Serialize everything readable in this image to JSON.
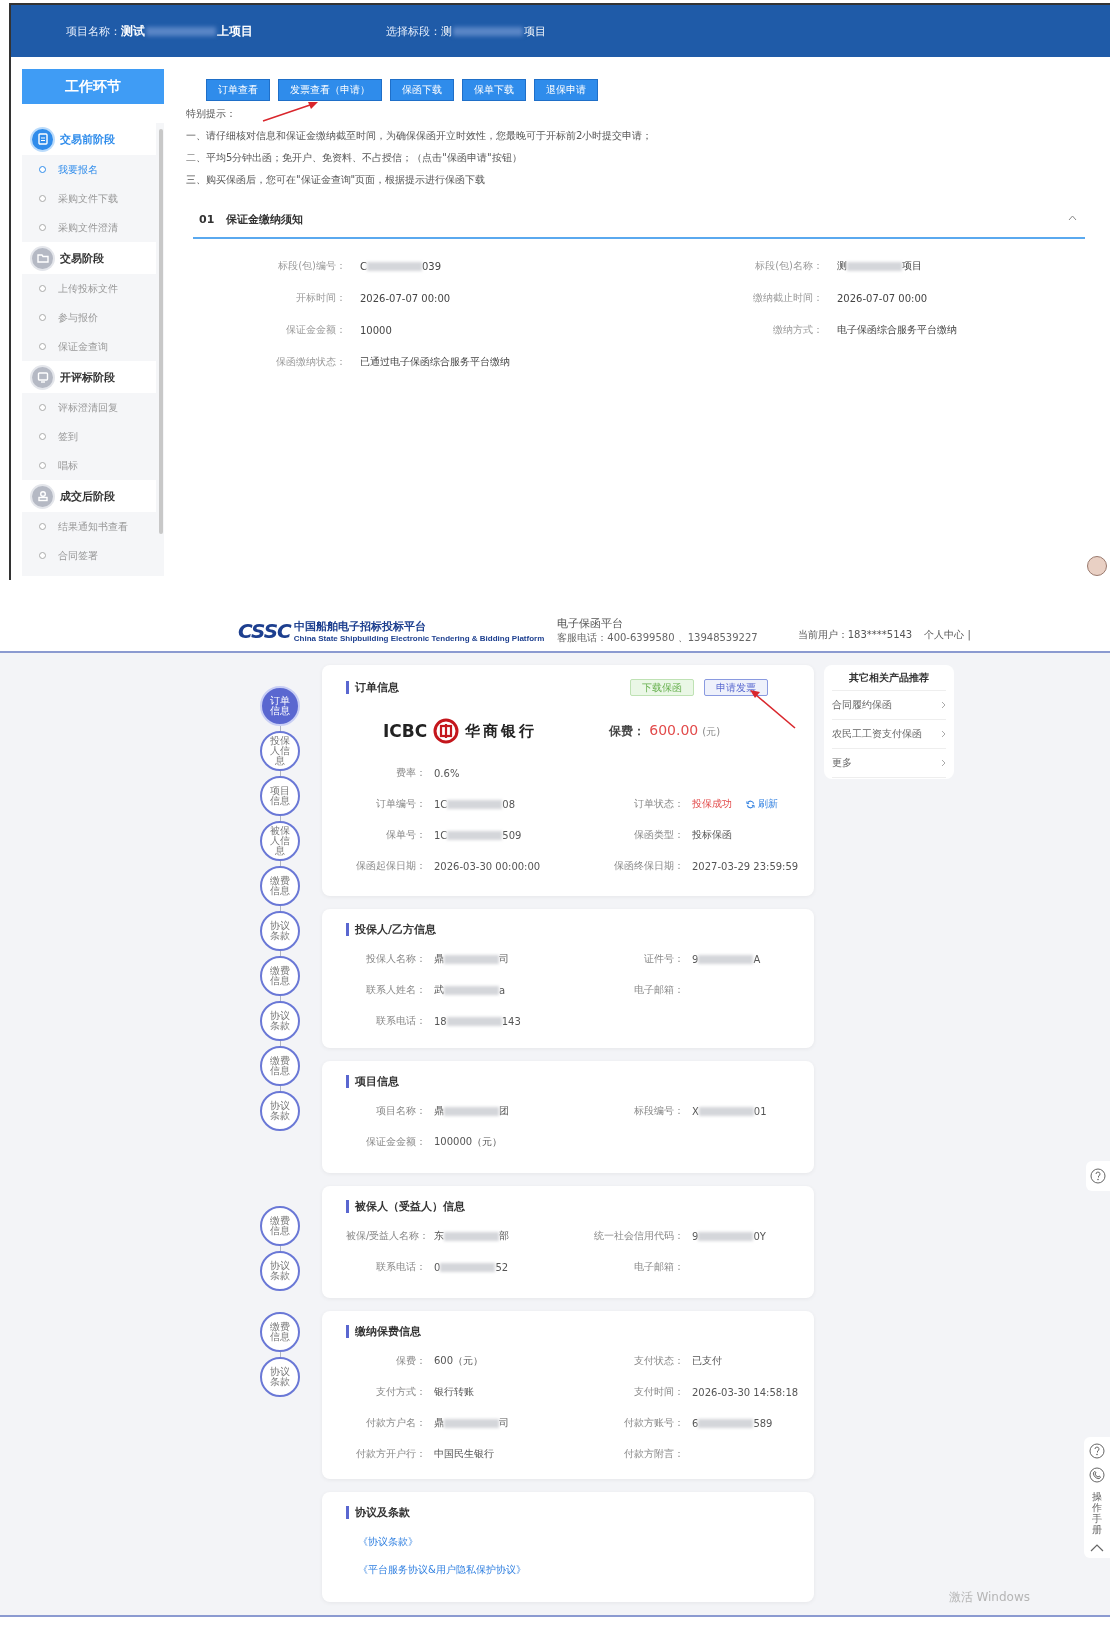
{
  "top_screen": {
    "header": {
      "project_label": "项目名称：",
      "project_value": "测试",
      "project_value_end": "上项目",
      "section_label": "选择标段：",
      "section_value": "测",
      "section_value_end": "项目"
    },
    "sidebar": {
      "title": "工作环节",
      "phases": [
        {
          "label": "交易前阶段",
          "selected": true,
          "items": [
            {
              "label": "我要报名",
              "selected": true
            },
            {
              "label": "采购文件下载",
              "selected": false
            },
            {
              "label": "采购文件澄清",
              "selected": false
            }
          ]
        },
        {
          "label": "交易阶段",
          "selected": false,
          "items": [
            {
              "label": "上传投标文件",
              "selected": false
            },
            {
              "label": "参与报价",
              "selected": false
            },
            {
              "label": "保证金查询",
              "selected": false
            }
          ]
        },
        {
          "label": "开评标阶段",
          "selected": false,
          "items": [
            {
              "label": "评标澄清回复",
              "selected": false
            },
            {
              "label": "签到",
              "selected": false
            },
            {
              "label": "唱标",
              "selected": false
            }
          ]
        },
        {
          "label": "成交后阶段",
          "selected": false,
          "items": [
            {
              "label": "结果通知书查看",
              "selected": false
            },
            {
              "label": "合同签署",
              "selected": false
            }
          ]
        }
      ]
    },
    "actions": [
      "订单查看",
      "发票查看（申请）",
      "保函下载",
      "保单下载",
      "退保申请"
    ],
    "notice": {
      "title": "特别提示：",
      "lines": [
        "一、请仔细核对信息和保证金缴纳截至时间，为确保保函开立时效性，您最晚可于开标前2小时提交申请；",
        "二、平均5分钟出函；免开户、免资料、不占授信；（点击\"保函申请\"按钮）",
        "三、购买保函后，您可在\"保证金查询\"页面，根据提示进行保函下载"
      ]
    },
    "section": {
      "number": "01",
      "title": "保证金缴纳须知",
      "expanded": true
    },
    "fields": [
      {
        "label": "标段(包)编号：",
        "value": "C",
        "value_end": "039"
      },
      {
        "label": "标段(包)名称：",
        "value": "测",
        "value_end": "项目"
      },
      {
        "label": "开标时间：",
        "value": "2026-07-07 00:00"
      },
      {
        "label": "缴纳截止时间：",
        "value": "2026-07-07 00:00"
      },
      {
        "label": "保证金金额：",
        "value": "10000"
      },
      {
        "label": "缴纳方式：",
        "value": "电子保函综合服务平台缴纳"
      },
      {
        "label": "保函缴纳状态：",
        "value": "已通过电子保函综合服务平台缴纳"
      }
    ]
  },
  "bottom_screen": {
    "header": {
      "logo_mark": "CSSC",
      "logo_name": "中国船舶电子招标投标平台",
      "logo_subtitle": "China State Shipbuilding Electronic Tendering & Bidding Platform",
      "platform": "电子保函平台",
      "hotline": "客服电话：400-6399580 、13948539227",
      "user": "当前用户：183****5143",
      "user_center": "个人中心 |"
    },
    "timeline": [
      [
        {
          "label": "订单信息",
          "selected": true
        },
        {
          "label": "投保人信息",
          "selected": false
        },
        {
          "label": "项目信息",
          "selected": false
        },
        {
          "label": "被保人信息",
          "selected": false
        },
        {
          "label": "缴费信息",
          "selected": false
        },
        {
          "label": "协议条款",
          "selected": false
        },
        {
          "label": "缴费信息",
          "selected": false
        },
        {
          "label": "协议条款",
          "selected": false
        },
        {
          "label": "缴费信息",
          "selected": false
        },
        {
          "label": "协议条款",
          "selected": false
        }
      ],
      [
        {
          "label": "缴费信息",
          "selected": false
        },
        {
          "label": "协议条款",
          "selected": false
        }
      ],
      [
        {
          "label": "缴费信息",
          "selected": false
        },
        {
          "label": "协议条款",
          "selected": false
        }
      ]
    ],
    "order": {
      "title": "订单信息",
      "buttons": [
        {
          "label": "下载保函",
          "kind": "success"
        },
        {
          "label": "申请发票",
          "kind": "primary"
        }
      ],
      "bank_code": "ICBC",
      "bank_name": "华商银行",
      "fee_label": "保费：",
      "fee_amount": "600.00",
      "fee_unit": "(元)",
      "rows": [
        [
          {
            "label": "费率：",
            "value": "0.6%"
          }
        ],
        [
          {
            "label": "订单编号：",
            "value": "1C",
            "value_end": "08"
          },
          {
            "label": "订单状态：",
            "value": "投保成功",
            "kind": "status",
            "action": "刷新"
          }
        ],
        [
          {
            "label": "保单号：",
            "value": "1C",
            "value_end": "509"
          },
          {
            "label": "保函类型：",
            "value": "投标保函"
          }
        ],
        [
          {
            "label": "保函起保日期：",
            "value": "2026-03-30 00:00:00"
          },
          {
            "label": "保函终保日期：",
            "value": "2027-03-29 23:59:59"
          }
        ]
      ]
    },
    "cards": [
      {
        "title": "投保人/乙方信息",
        "rows": [
          [
            {
              "label": "投保人名称：",
              "value": "鼎",
              "value_end": "司"
            },
            {
              "label": "证件号：",
              "value": "9",
              "value_end": "A"
            }
          ],
          [
            {
              "label": "联系人姓名：",
              "value": "武",
              "value_end": "a"
            },
            {
              "label": "电子邮箱："
            }
          ],
          [
            {
              "label": "联系电话：",
              "value": "18",
              "value_end": "143"
            }
          ]
        ]
      },
      {
        "title": "项目信息",
        "rows": [
          [
            {
              "label": "项目名称：",
              "value": "鼎",
              "value_end": "团"
            },
            {
              "label": "标段编号：",
              "value": "X",
              "value_end": "01"
            }
          ],
          [
            {
              "label": "保证金金额：",
              "value": "100000（元）"
            }
          ]
        ]
      },
      {
        "title": "被保人（受益人）信息",
        "rows": [
          [
            {
              "label": "被保/受益人名称：",
              "value": "东",
              "value_end": "部"
            },
            {
              "label": "统一社会信用代码：",
              "value": "9",
              "value_end": "0Y"
            }
          ],
          [
            {
              "label": "联系电话：",
              "value": "0",
              "value_end": "52"
            },
            {
              "label": "电子邮箱："
            }
          ]
        ]
      },
      {
        "title": "缴纳保费信息",
        "rows": [
          [
            {
              "label": "保费：",
              "value": "600（元）"
            },
            {
              "label": "支付状态：",
              "value": "已支付"
            }
          ],
          [
            {
              "label": "支付方式：",
              "value": "银行转账"
            },
            {
              "label": "支付时间：",
              "value": "2026-03-30 14:58:18"
            }
          ],
          [
            {
              "label": "付款方户名：",
              "value": "鼎",
              "value_end": "司"
            },
            {
              "label": "付款方账号：",
              "value": "6",
              "value_end": "589"
            }
          ],
          [
            {
              "label": "付款方开户行：",
              "value": "中国民生银行"
            },
            {
              "label": "付款方附言："
            }
          ]
        ]
      }
    ],
    "agreement": {
      "title": "协议及条款",
      "links": [
        "《协议条款》",
        "《平台服务协议&用户隐私保护协议》"
      ]
    },
    "recommend": {
      "title": "其它相关产品推荐",
      "items": [
        "合同履约保函",
        "农民工工资支付保函",
        "更多"
      ]
    },
    "manual": "操作手册",
    "os_notice": "激活 Windows"
  }
}
